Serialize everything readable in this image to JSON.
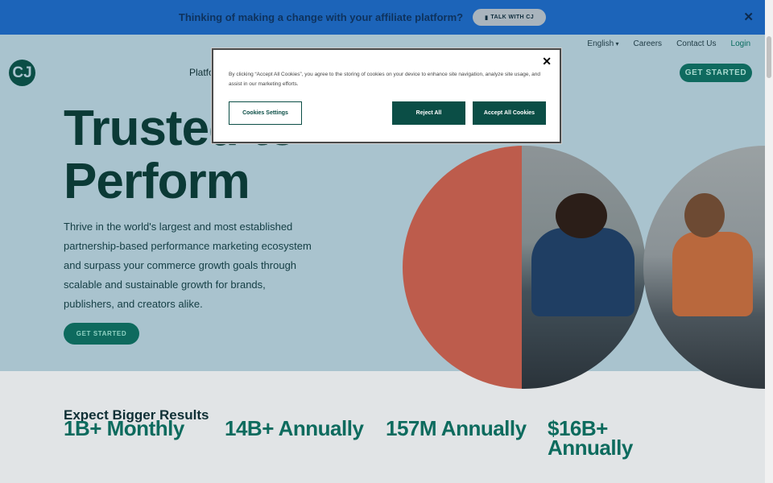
{
  "banner": {
    "text": "Thinking of making a change with your affiliate platform?",
    "button_label": "TALK WITH CJ",
    "button_icon": "phone-icon",
    "close_glyph": "✕"
  },
  "util_nav": {
    "language": "English",
    "careers": "Careers",
    "contact": "Contact Us",
    "login": "Login"
  },
  "header": {
    "logo_text": "CJ",
    "nav_partial": "Platfo",
    "cta": "GET STARTED"
  },
  "hero": {
    "title_line1": "Trusted to",
    "title_line2": "Perform",
    "lead": "Thrive in the world's largest and most established partnership-based performance marketing ecosystem and surpass your commerce growth goals through scalable and sustainable growth for brands, publishers, and creators alike.",
    "cta": "GET STARTED"
  },
  "results": {
    "title": "Expect Bigger Results",
    "stats": [
      "1B+ Monthly",
      "14B+ Annually",
      "157M Annually",
      "$16B+ Annually"
    ]
  },
  "cookie_modal": {
    "text": "By clicking “Accept All Cookies”, you agree to the storing of cookies on your device to enhance site navigation, analyze site usage, and assist in our marketing efforts.",
    "settings_label": "Cookies Settings",
    "reject_label": "Reject All",
    "accept_label": "Accept All Cookies",
    "close_glyph": "✕"
  },
  "colors": {
    "banner_bg": "#1c64b9",
    "brand_green": "#0b4e46",
    "accent_orange": "#bd5c4c"
  }
}
